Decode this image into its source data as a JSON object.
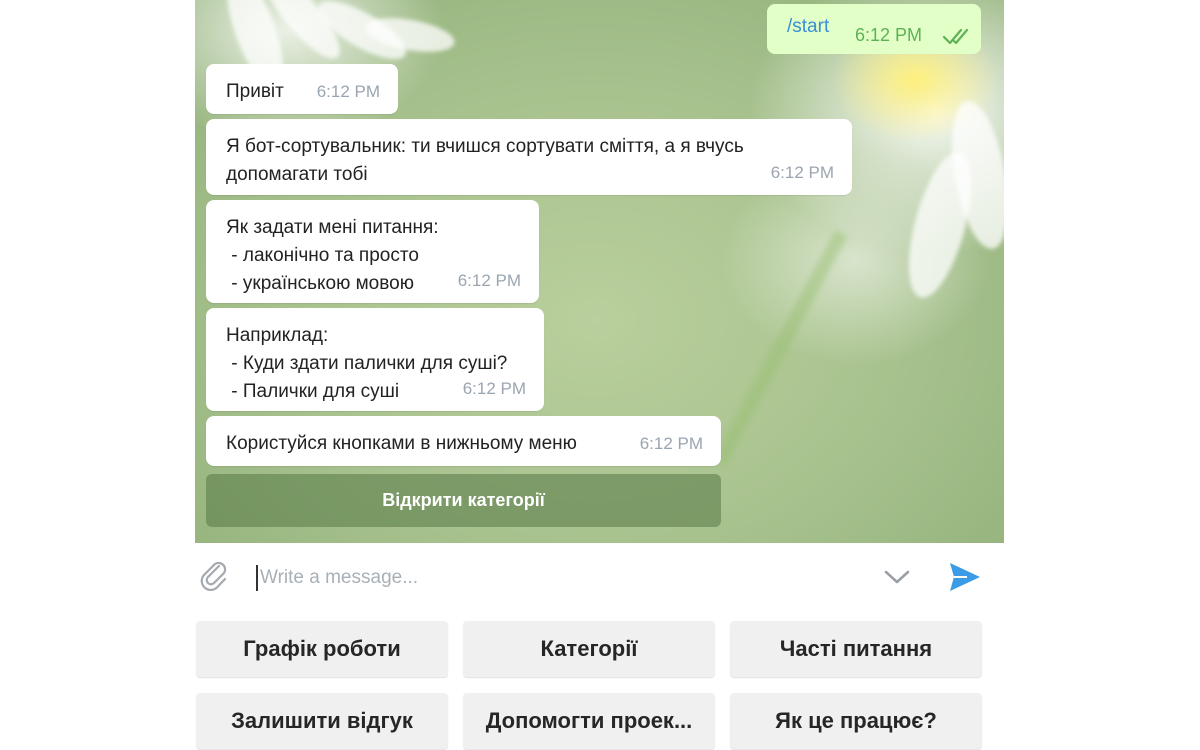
{
  "chat": {
    "outgoing": {
      "text": "/start",
      "time": "6:12 PM"
    },
    "messages": [
      {
        "text": "Привіт",
        "time": "6:12 PM"
      },
      {
        "text": "Я бот-сортувальник: ти вчишся сортувати сміття, а я вчусь\nдопомагати тобі",
        "time": "6:12 PM"
      },
      {
        "text": "Як задати мені питання:\n - лаконічно та просто\n - українською мовою",
        "time": "6:12 PM"
      },
      {
        "text": "Наприклад:\n - Куди здати палички для суші?\n - Палички для суші",
        "time": "6:12 PM"
      },
      {
        "text": "Користуйся кнопками в нижньому меню",
        "time": "6:12 PM"
      }
    ],
    "inline_button": "Відкрити категорії"
  },
  "input": {
    "placeholder": "Write a message...",
    "value": ""
  },
  "icons": {
    "attach": "paperclip-icon",
    "keyboard_toggle": "chevron-down-icon",
    "send": "send-icon",
    "read_status": "double-check-icon"
  },
  "colors": {
    "outgoing_bubble": "#e1ffc7",
    "link": "#3a8fd8",
    "send_accent": "#3a9be6"
  },
  "keyboard": {
    "buttons": [
      "Графік роботи",
      "Категорії",
      "Часті питання",
      "Залишити відгук",
      "Допомогти проек...",
      "Як це працює?"
    ]
  }
}
